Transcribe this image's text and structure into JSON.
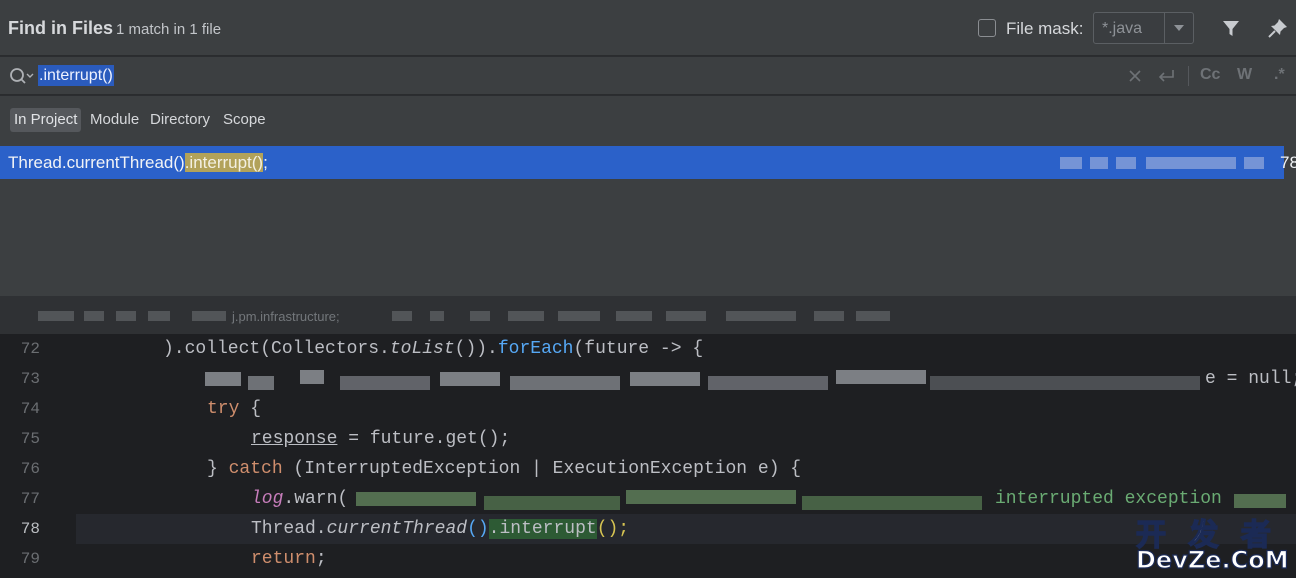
{
  "header": {
    "title": "Find in Files",
    "subtitle": "1 match in 1 file",
    "file_mask_label": "File mask:",
    "file_mask_value": "*.java",
    "file_mask_checked": false,
    "filter_icon": "filter-icon",
    "pin_icon": "pin-icon"
  },
  "search": {
    "query": ".interrupt()",
    "icons": [
      "search-history-icon",
      "clear-icon",
      "new-line-icon",
      "match-case-icon",
      "words-icon",
      "regex-icon"
    ],
    "match_case_label": "Cc",
    "words_label": "W",
    "regex_label": ".*"
  },
  "scopes": {
    "items": [
      {
        "label": "In Project",
        "active": true
      },
      {
        "label": "Module",
        "active": false
      },
      {
        "label": "Directory",
        "active": false
      },
      {
        "label": "Scope",
        "active": false
      }
    ]
  },
  "results": {
    "rows": [
      {
        "prefix": "Thread.currentThread()",
        "match": ".interrupt()",
        "suffix": ";",
        "line": "78"
      }
    ]
  },
  "preview": {
    "path_fragment": "j.pm.infrastructure;",
    "current_line": 78,
    "lines": [
      {
        "num": "72",
        "seg": [
          ").collect(Collectors.",
          "toList",
          "()).",
          "forEach",
          "(future -> {"
        ]
      },
      {
        "num": "73",
        "tail": "e = null;"
      },
      {
        "num": "74",
        "kw": "try",
        "rest": " {"
      },
      {
        "num": "75",
        "field": "response",
        "rest": " = future.get();"
      },
      {
        "num": "76",
        "close": "} ",
        "kw": "catch",
        "rest": " (InterruptedException | ExecutionException e) {"
      },
      {
        "num": "77",
        "field": "log",
        "call": ".warn(",
        "str": "interrupted exception"
      },
      {
        "num": "78",
        "prefix": "Thread.",
        "method": "currentThread",
        "parens": "()",
        "match": ".interrupt",
        "end": "();"
      },
      {
        "num": "79",
        "kw": "return",
        "rest": ";"
      }
    ]
  },
  "watermark": {
    "top": "开 发 者",
    "bottom": "DevZe.CoM"
  }
}
